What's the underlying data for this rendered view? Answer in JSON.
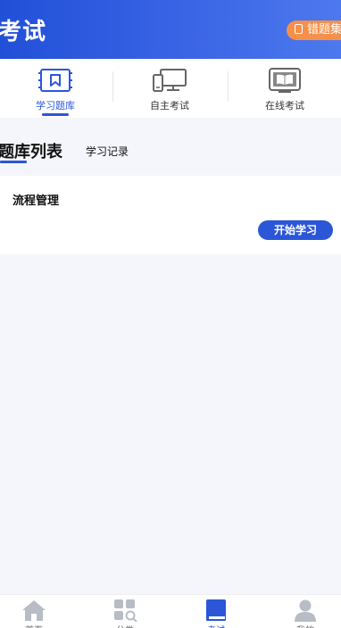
{
  "header": {
    "title": "考试",
    "wrong_button_label": "错题集"
  },
  "tabs": [
    {
      "label": "学习题库",
      "icon": "question-bank-icon",
      "active": true
    },
    {
      "label": "自主考试",
      "icon": "computer-icon",
      "active": false
    },
    {
      "label": "在线考试",
      "icon": "online-book-icon",
      "active": false
    }
  ],
  "section": {
    "title": "题库列表",
    "record_link": "学习记录"
  },
  "list": [
    {
      "title": "流程管理",
      "button_label": "开始学习"
    }
  ],
  "bottom_nav": [
    {
      "label": "首页",
      "icon": "home-icon",
      "active": false
    },
    {
      "label": "分类",
      "icon": "category-icon",
      "active": false
    },
    {
      "label": "考试",
      "icon": "book-icon",
      "active": true
    },
    {
      "label": "我的",
      "icon": "profile-icon",
      "active": false
    }
  ],
  "colors": {
    "primary": "#2b56d8",
    "accent_orange": "#f5904a",
    "background": "#f4f6fb"
  }
}
